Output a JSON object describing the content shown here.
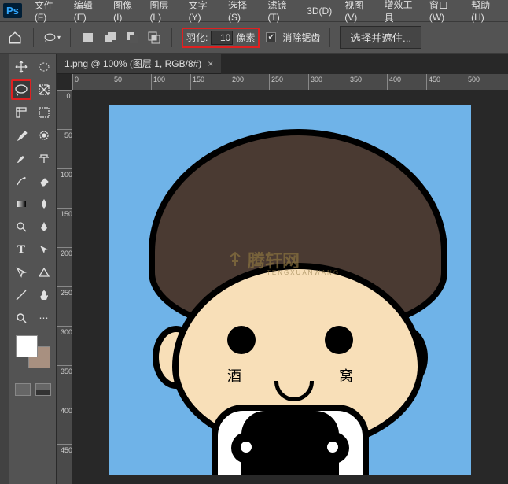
{
  "app_icon": "Ps",
  "menu": [
    "文件(F)",
    "编辑(E)",
    "图像(I)",
    "图层(L)",
    "文字(Y)",
    "选择(S)",
    "滤镜(T)",
    "3D(D)",
    "视图(V)",
    "增效工具",
    "窗口(W)",
    "帮助(H)"
  ],
  "options": {
    "feather_label": "羽化:",
    "feather_value": "10",
    "feather_unit": "像素",
    "antialias_checked": true,
    "antialias_label": "消除锯齿",
    "select_mask_btn": "选择并遮住..."
  },
  "tab": {
    "title": "1.png @ 100% (图层 1, RGB/8#)",
    "close": "×"
  },
  "ruler_h": [
    "0",
    "50",
    "100",
    "150",
    "200",
    "250",
    "300",
    "350",
    "400",
    "450",
    "500"
  ],
  "ruler_v": [
    "0",
    "50",
    "100",
    "150",
    "200",
    "250",
    "300",
    "350",
    "400",
    "450"
  ],
  "watermark": {
    "text": "腾轩网",
    "sub": "TENGXUANWANG"
  },
  "cheek": {
    "left": "酒",
    "right": "窝"
  },
  "swatch": {
    "fg": "#ffffff",
    "bg": "#a89080"
  }
}
